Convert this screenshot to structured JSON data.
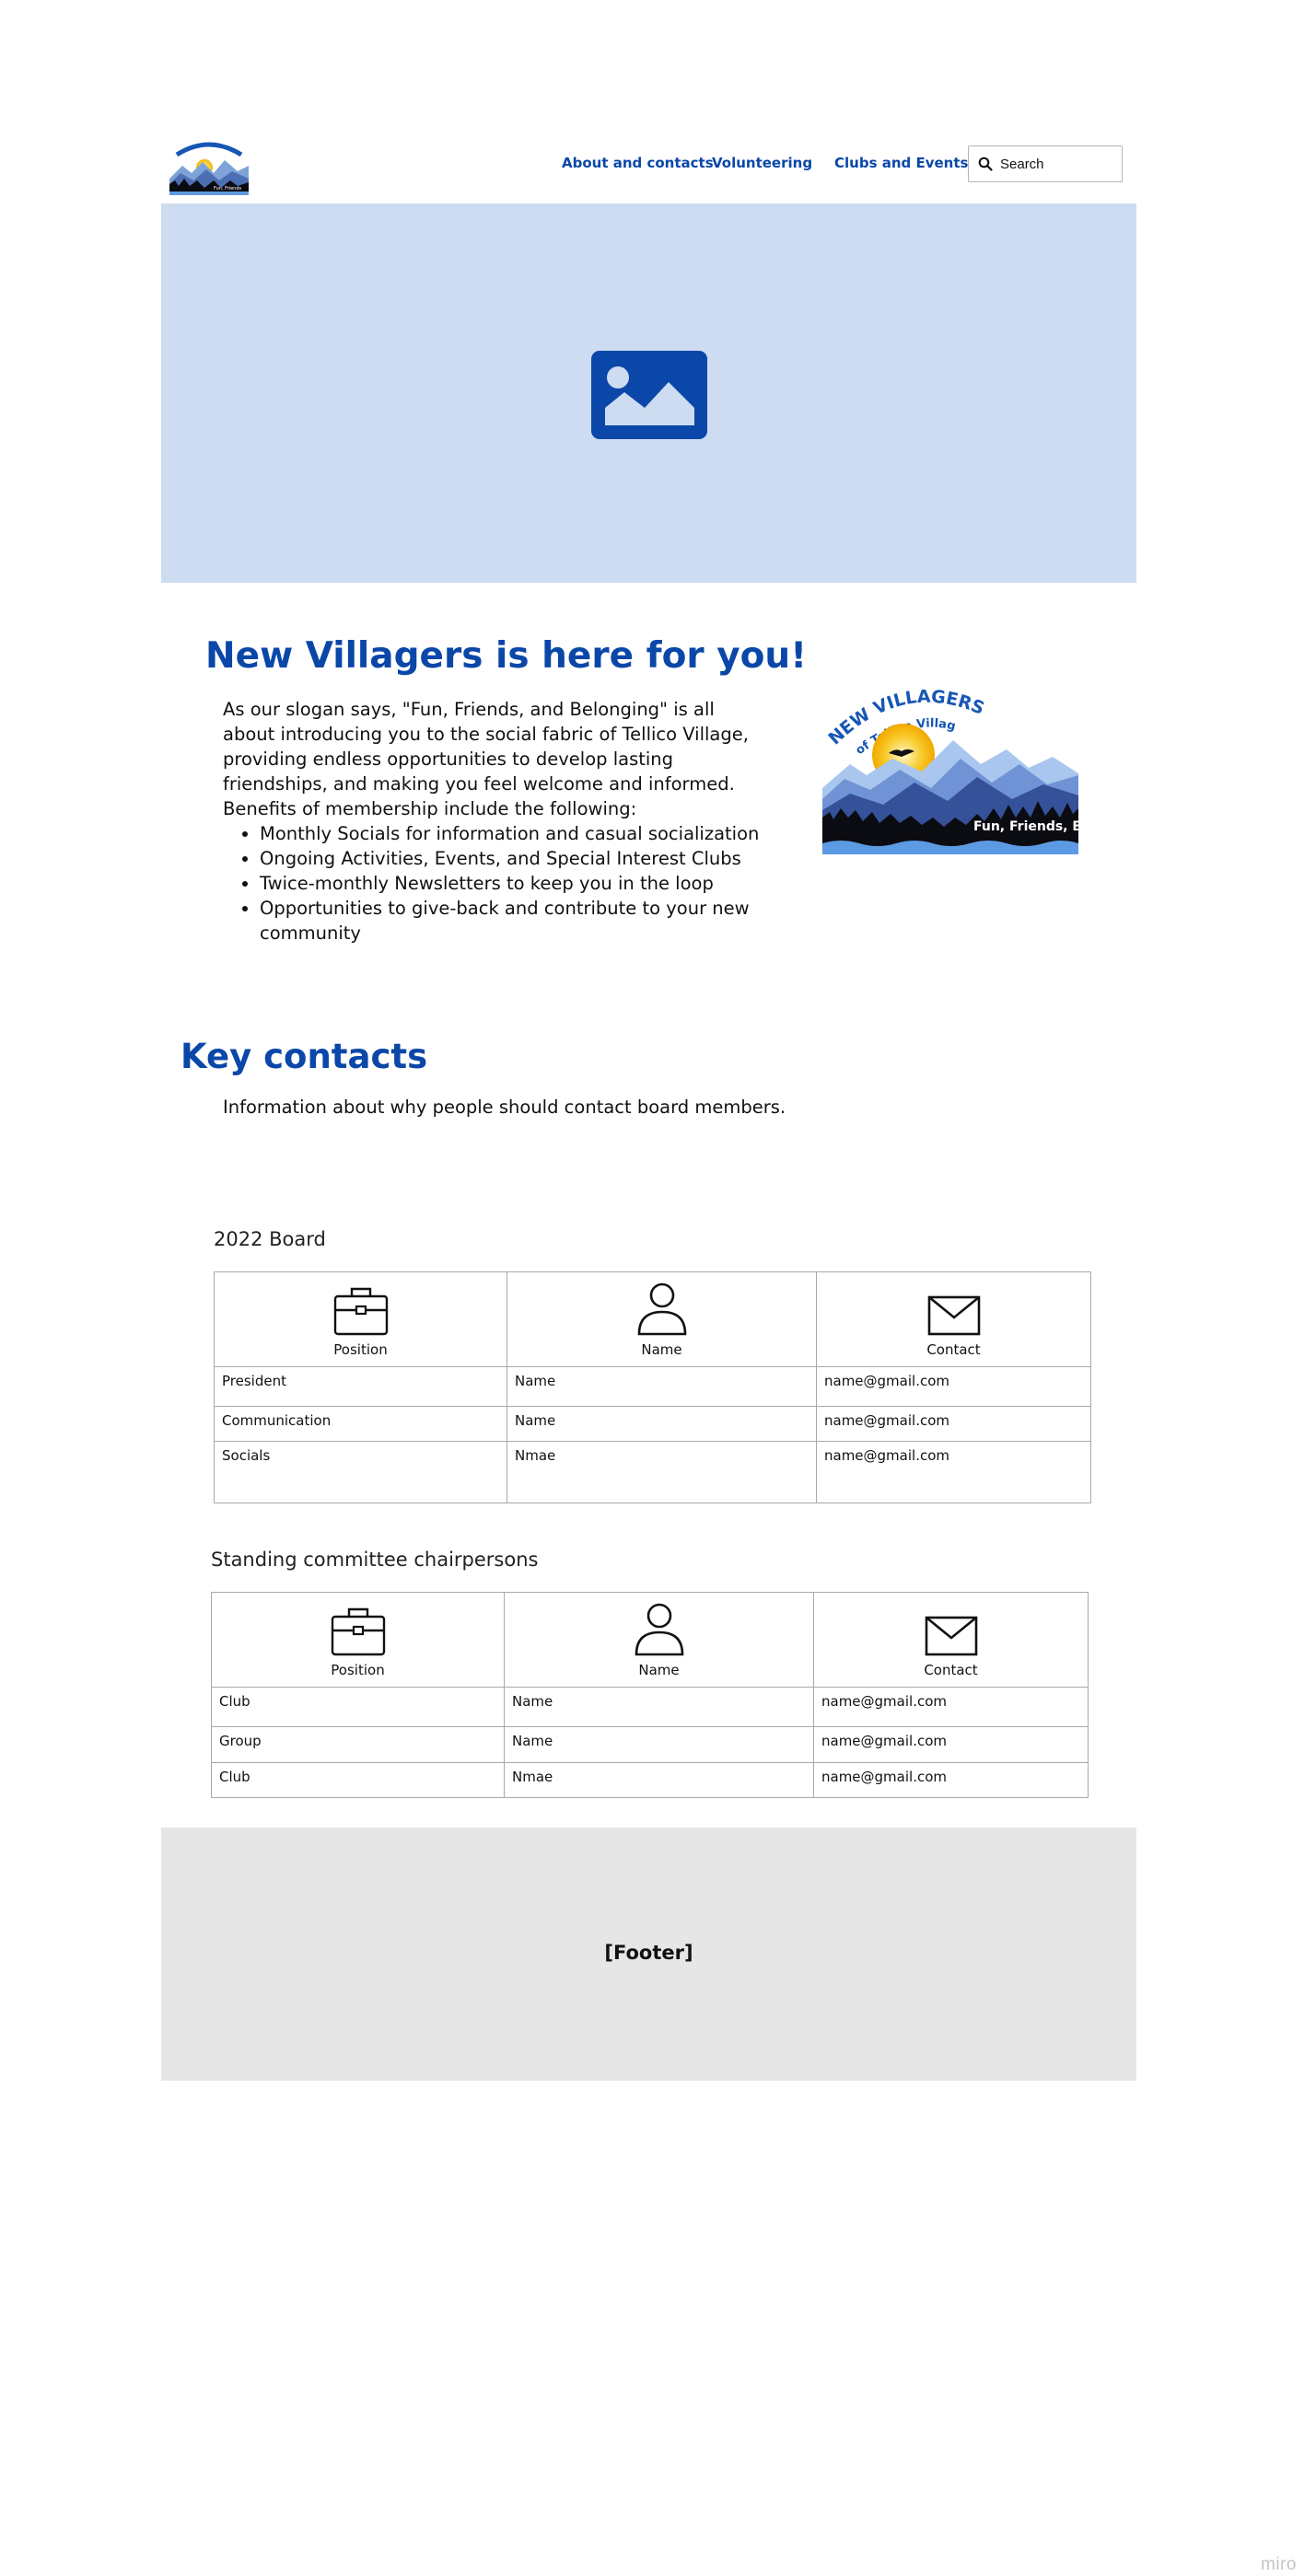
{
  "header": {
    "logo_text": "NEW VILLAGERS CLUB",
    "nav": [
      {
        "label": "About and contacts"
      },
      {
        "label": "Volunteering"
      },
      {
        "label": "Clubs and Events"
      }
    ],
    "search": {
      "placeholder": "Search"
    }
  },
  "hero": {
    "icon": "image-placeholder-icon",
    "bg_color": "#cddcf1",
    "icon_color": "#0a47a8"
  },
  "intro": {
    "heading": "New Villagers is here for you!",
    "paragraph": "As our slogan says, \"Fun, Friends, and Belonging\" is all about introducing you to the social fabric of Tellico Village, providing endless opportunities to develop lasting friendships, and making you feel welcome and informed.  Benefits of membership include the following:",
    "benefits": [
      "Monthly Socials for information and casual socialization",
      "Ongoing Activities, Events, and Special Interest Clubs",
      "Twice-monthly Newsletters to keep you in the loop",
      "Opportunities to give-back and contribute to your new community"
    ],
    "logo": {
      "title": "NEW VILLAGERS CLUB",
      "subtitle": "of Tellico Village",
      "slogan": "Fun, Friends, Belonging"
    }
  },
  "key_contacts": {
    "heading": "Key contacts",
    "description": "Information about why people should contact board members."
  },
  "board": {
    "title": "2022 Board",
    "headers": [
      "Position",
      "Name",
      "Contact"
    ],
    "rows": [
      [
        "President",
        "Name",
        "name@gmail.com"
      ],
      [
        "Communication",
        "Name",
        "name@gmail.com"
      ],
      [
        "Socials",
        "Nmae",
        "name@gmail.com"
      ]
    ]
  },
  "committee": {
    "title": "Standing committee chairpersons",
    "headers": [
      "Position",
      "Name",
      "Contact"
    ],
    "rows": [
      [
        "Club",
        "Name",
        "name@gmail.com"
      ],
      [
        "Group",
        "Name",
        "name@gmail.com"
      ],
      [
        "Club",
        "Nmae",
        "name@gmail.com"
      ]
    ]
  },
  "footer": {
    "label": "[Footer]"
  },
  "watermark": "miro",
  "colors": {
    "brand_blue": "#0a47a8",
    "footer_bg": "#e6e6e6"
  }
}
